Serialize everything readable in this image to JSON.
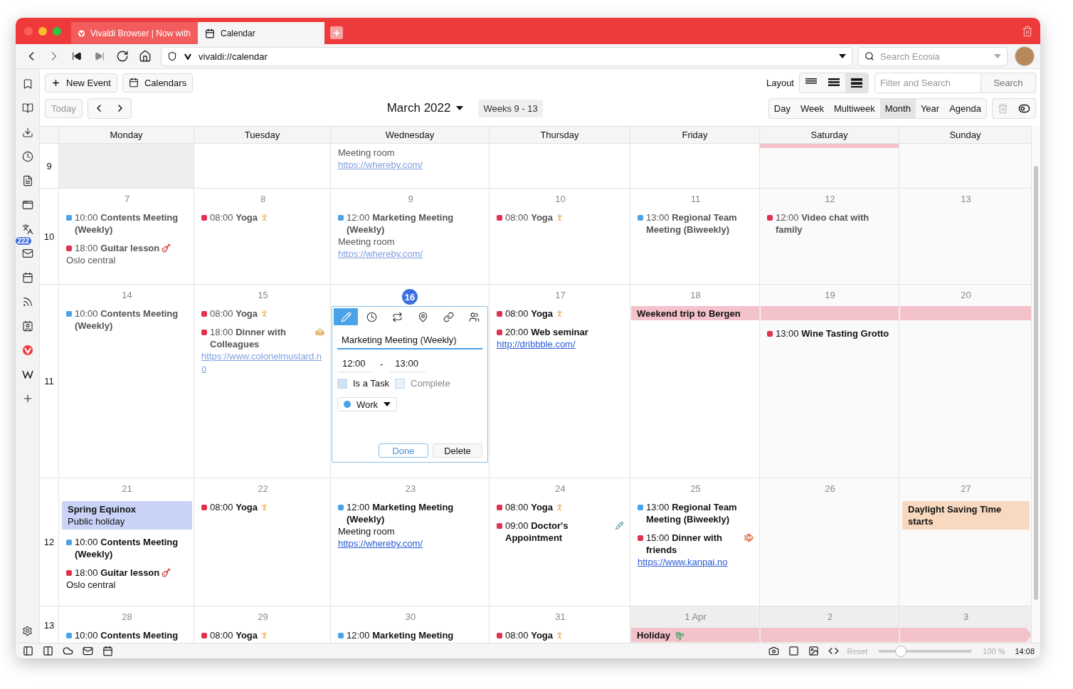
{
  "window": {
    "tabs": [
      {
        "label": "Vivaldi Browser | Now with",
        "selected": false,
        "kind": "site"
      },
      {
        "label": "Calendar",
        "selected": true,
        "kind": "calendar"
      }
    ]
  },
  "address_bar": {
    "url": "vivaldi://calendar"
  },
  "search": {
    "placeholder": "Search Ecosia"
  },
  "panel": {
    "mail_badge": "222"
  },
  "toolbar": {
    "new_event": "New Event",
    "calendars": "Calendars",
    "layout_label": "Layout",
    "layouts": [
      {
        "selected": false
      },
      {
        "selected": false
      },
      {
        "selected": true
      }
    ],
    "filter_placeholder": "Filter and Search",
    "search_button": "Search",
    "today": {
      "label": "Today",
      "disabled": true
    },
    "month": "March 2022",
    "weeks": "Weeks 9 - 13",
    "views": [
      {
        "label": "Day",
        "selected": false
      },
      {
        "label": "Week",
        "selected": false
      },
      {
        "label": "Multiweek",
        "selected": false
      },
      {
        "label": "Month",
        "selected": true
      },
      {
        "label": "Year",
        "selected": false
      },
      {
        "label": "Agenda",
        "selected": false
      }
    ],
    "trash_disabled": true
  },
  "calendar": {
    "weekdays": [
      "Monday",
      "Tuesday",
      "Wednesday",
      "Thursday",
      "Friday",
      "Saturday",
      "Sunday"
    ],
    "weeks": [
      {
        "number": "9",
        "days": [
          {
            "muted": true
          },
          {
            "muted": false
          },
          {
            "muted": false,
            "events": [
              {
                "kind": "continuation",
                "past": true,
                "location": "Meeting room",
                "link": "https://whereby.com/"
              }
            ]
          },
          {
            "muted": false
          },
          {
            "muted": false
          },
          {
            "muted": false,
            "bar": {
              "color": "#f4c2ca",
              "continues": false
            }
          },
          {
            "muted": false
          }
        ]
      },
      {
        "number": "10",
        "days": [
          {
            "date": "7",
            "muted": false,
            "events": [
              {
                "kind": "timed",
                "past": true,
                "color": "#4aa3e8",
                "time": "10:00",
                "title": "Contents Meeting (Weekly)"
              },
              {
                "kind": "timed",
                "past": true,
                "color": "#e0324f",
                "time": "18:00",
                "title": "Guitar lesson",
                "location": "Oslo central"
              }
            ]
          },
          {
            "date": "8",
            "muted": false,
            "events": [
              {
                "kind": "timed",
                "past": true,
                "color": "#e0324f",
                "time": "08:00",
                "title": "Yoga"
              }
            ]
          },
          {
            "date": "9",
            "muted": false,
            "events": [
              {
                "kind": "timed",
                "past": true,
                "color": "#4aa3e8",
                "time": "12:00",
                "title": "Marketing Meeting (Weekly)",
                "location": "Meeting room",
                "link": "https://whereby.com/"
              }
            ]
          },
          {
            "date": "10",
            "muted": false,
            "events": [
              {
                "kind": "timed",
                "past": true,
                "color": "#e0324f",
                "time": "08:00",
                "title": "Yoga"
              }
            ]
          },
          {
            "date": "11",
            "muted": false,
            "events": [
              {
                "kind": "timed",
                "past": true,
                "color": "#4aa3e8",
                "time": "13:00",
                "title": "Regional Team Meeting (Biweekly)"
              }
            ]
          },
          {
            "date": "12",
            "muted": false,
            "events": [
              {
                "kind": "timed",
                "past": true,
                "color": "#e0324f",
                "time": "12:00",
                "title": "Video chat with family"
              }
            ]
          },
          {
            "date": "13",
            "muted": false
          }
        ]
      },
      {
        "number": "11",
        "days": [
          {
            "date": "14",
            "muted": false,
            "events": [
              {
                "kind": "timed",
                "past": true,
                "color": "#4aa3e8",
                "time": "10:00",
                "title": "Contents Meeting (Weekly)"
              }
            ]
          },
          {
            "date": "15",
            "muted": false,
            "events": [
              {
                "kind": "timed",
                "past": true,
                "color": "#e0324f",
                "time": "08:00",
                "title": "Yoga"
              },
              {
                "kind": "timed",
                "past": true,
                "color": "#e0324f",
                "time": "18:00",
                "title": "Dinner with Colleagues",
                "link": "https://www.colonelmustard.no"
              }
            ]
          },
          {
            "date": "16",
            "today": true,
            "muted": false,
            "editor": {
              "tabs": [
                {
                  "selected": true
                },
                {
                  "selected": false
                },
                {
                  "selected": false
                },
                {
                  "selected": false
                },
                {
                  "selected": false
                },
                {
                  "selected": false
                }
              ],
              "title": "Marketing Meeting (Weekly)",
              "start": "12:00",
              "separator": "-",
              "end": "13:00",
              "checkboxes": [
                {
                  "label": "Is a Task",
                  "checked": false,
                  "disabled": false
                },
                {
                  "label": "Complete",
                  "checked": false,
                  "disabled": true
                }
              ],
              "calendar": {
                "name": "Work",
                "color": "#4aa3e8"
              },
              "done": "Done",
              "delete": "Delete"
            }
          },
          {
            "date": "17",
            "muted": false,
            "events": [
              {
                "kind": "timed",
                "past": false,
                "color": "#e0324f",
                "time": "08:00",
                "title": "Yoga"
              },
              {
                "kind": "timed",
                "past": false,
                "color": "#e0324f",
                "time": "20:00",
                "title": "Web seminar",
                "link": "http://dribbble.com/"
              }
            ]
          },
          {
            "date": "18",
            "muted": false,
            "bar": {
              "title": "Weekend trip to Bergen",
              "color": "#f4c2ca",
              "continues": false
            }
          },
          {
            "date": "19",
            "muted": false,
            "bar": {
              "color": "#f4c2ca",
              "continues": false
            },
            "events": [
              {
                "kind": "timed",
                "past": false,
                "color": "#e0324f",
                "time": "13:00",
                "title": "Wine Tasting Grotto"
              }
            ]
          },
          {
            "date": "20",
            "muted": false,
            "bar": {
              "color": "#f4c2ca",
              "continues": false
            }
          }
        ]
      },
      {
        "number": "12",
        "days": [
          {
            "date": "21",
            "muted": false,
            "events": [
              {
                "kind": "allday",
                "past": false,
                "color": "#c9d3f7",
                "title": "Spring Equinox",
                "subtitle": "Public holiday"
              },
              {
                "kind": "timed",
                "past": false,
                "color": "#4aa3e8",
                "time": "10:00",
                "title": "Contents Meeting (Weekly)"
              },
              {
                "kind": "timed",
                "past": false,
                "color": "#e0324f",
                "time": "18:00",
                "title": "Guitar lesson",
                "location": "Oslo central"
              }
            ]
          },
          {
            "date": "22",
            "muted": false,
            "events": [
              {
                "kind": "timed",
                "past": false,
                "color": "#e0324f",
                "time": "08:00",
                "title": "Yoga"
              }
            ]
          },
          {
            "date": "23",
            "muted": false,
            "events": [
              {
                "kind": "timed",
                "past": false,
                "color": "#4aa3e8",
                "time": "12:00",
                "title": "Marketing Meeting (Weekly)",
                "location": "Meeting room",
                "link": "https://whereby.com/"
              }
            ]
          },
          {
            "date": "24",
            "muted": false,
            "events": [
              {
                "kind": "timed",
                "past": false,
                "color": "#e0324f",
                "time": "08:00",
                "title": "Yoga"
              },
              {
                "kind": "timed",
                "past": false,
                "color": "#e0324f",
                "time": "09:00",
                "title": "Doctor's Appointment"
              }
            ]
          },
          {
            "date": "25",
            "muted": false,
            "events": [
              {
                "kind": "timed",
                "past": false,
                "color": "#4aa3e8",
                "time": "13:00",
                "title": "Regional Team Meeting (Biweekly)"
              },
              {
                "kind": "timed",
                "past": false,
                "color": "#e0324f",
                "time": "15:00",
                "title": "Dinner with friends",
                "link": "https://www.kanpai.no"
              }
            ]
          },
          {
            "date": "26",
            "muted": false
          },
          {
            "date": "27",
            "muted": false,
            "events": [
              {
                "kind": "allday",
                "past": false,
                "color": "#f8d9bf",
                "title": "Daylight Saving Time starts"
              }
            ]
          }
        ]
      },
      {
        "number": "13",
        "days": [
          {
            "date": "28",
            "muted": false,
            "events": [
              {
                "kind": "timed",
                "past": false,
                "color": "#4aa3e8",
                "time": "10:00",
                "title": "Contents Meeting"
              }
            ]
          },
          {
            "date": "29",
            "muted": false,
            "events": [
              {
                "kind": "timed",
                "past": false,
                "color": "#e0324f",
                "time": "08:00",
                "title": "Yoga"
              }
            ]
          },
          {
            "date": "30",
            "muted": false,
            "events": [
              {
                "kind": "timed",
                "past": false,
                "color": "#4aa3e8",
                "time": "12:00",
                "title": "Marketing Meeting"
              }
            ]
          },
          {
            "date": "31",
            "muted": false,
            "events": [
              {
                "kind": "timed",
                "past": false,
                "color": "#e0324f",
                "time": "08:00",
                "title": "Yoga"
              }
            ]
          },
          {
            "date": "1 Apr",
            "muted": true,
            "bar": {
              "title": "Holiday",
              "color": "#f4c2ca",
              "continues": false
            }
          },
          {
            "date": "2",
            "muted": true,
            "bar": {
              "color": "#f4c2ca",
              "continues": false
            }
          },
          {
            "date": "3",
            "muted": true,
            "bar": {
              "color": "#f4c2ca",
              "continues": true
            }
          }
        ]
      }
    ]
  },
  "status_bar": {
    "reset": "Reset",
    "zoom": {
      "level": 0.2
    },
    "zoom_label": "100 %",
    "clock": "14:08"
  }
}
